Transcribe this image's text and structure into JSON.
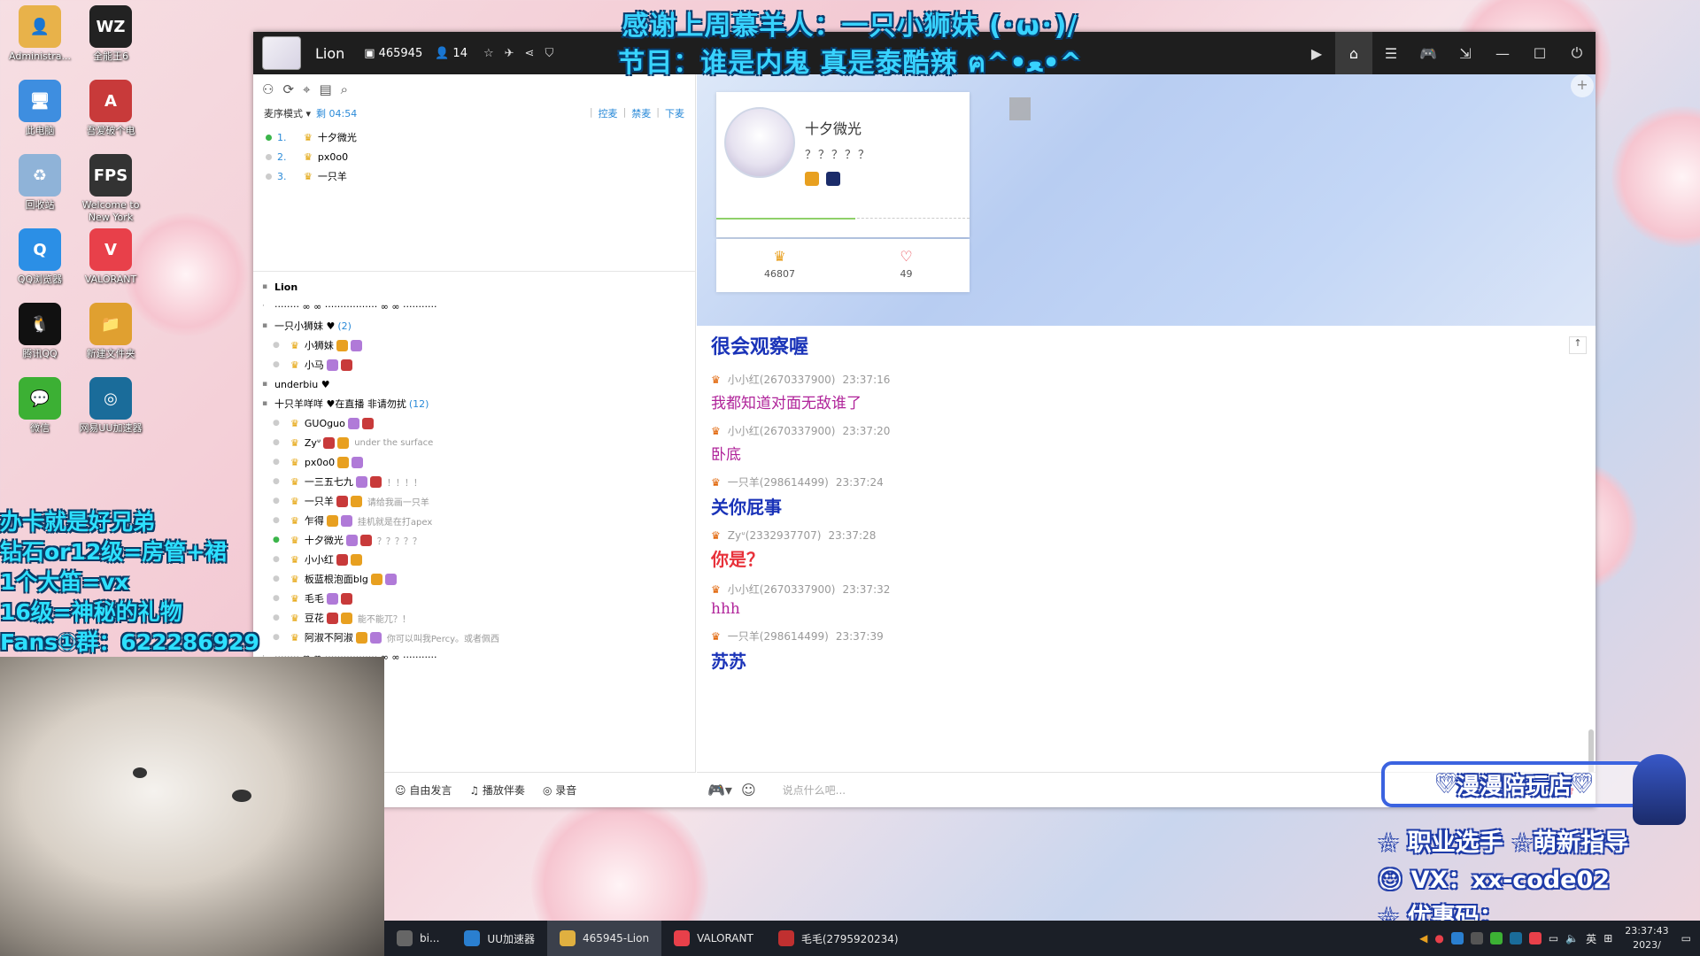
{
  "banner": {
    "line1": "感谢上周慕羊人：一只小狮妹 (･ω･)/",
    "line2": "节目：谁是内鬼 真是泰酷辣 ฅ^•ﻌ•^"
  },
  "desktop_icons": [
    {
      "label": "Administra...",
      "color": "#e8b24a",
      "glyph": "👤"
    },
    {
      "label": "全能王6",
      "color": "#222",
      "glyph": "WZ"
    },
    {
      "label": "此电脑",
      "color": "#3e8ee0",
      "glyph": "🖥"
    },
    {
      "label": "吾爱破个电",
      "color": "#c83a3a",
      "glyph": "A"
    },
    {
      "label": "回收站",
      "color": "#8fb3d8",
      "glyph": "♻"
    },
    {
      "label": "Welcome to New York",
      "color": "#333",
      "glyph": "FPS"
    },
    {
      "label": "QQ浏览器",
      "color": "#2b8fe6",
      "glyph": "Q"
    },
    {
      "label": "VALORANT",
      "color": "#e8404a",
      "glyph": "V"
    },
    {
      "label": "腾讯QQ",
      "color": "#111",
      "glyph": "🐧"
    },
    {
      "label": "新建文件夹",
      "color": "#e0a030",
      "glyph": "📁"
    },
    {
      "label": "微信",
      "color": "#3cb034",
      "glyph": "💬"
    },
    {
      "label": "网易UU加速器",
      "color": "#1a6c9a",
      "glyph": "◎"
    }
  ],
  "promo": {
    "line1": "办卡就是好兄弟",
    "line2": "钻石or12级=房管+裙",
    "line3": "1个大笛=vx",
    "line4": "16级=神秘的礼物",
    "line5": "Fans①群：622286929"
  },
  "titlebar": {
    "name": "Lion",
    "room_id": "465945",
    "online": "14",
    "icons": [
      "star-icon",
      "fly-icon",
      "share-icon",
      "shield-icon"
    ],
    "right_buttons": [
      "video-icon",
      "home-icon",
      "list-icon",
      "gamepad-icon",
      "download-icon",
      "minimize-icon",
      "maximize-icon",
      "power-icon"
    ]
  },
  "left": {
    "mode_label": "麦序模式",
    "timer": "剩 04:54",
    "ops": [
      "控麦",
      "禁麦",
      "下麦"
    ],
    "queue": [
      {
        "num": "1.",
        "name": "十夕微光",
        "on": true
      },
      {
        "num": "2.",
        "name": "px0o0",
        "on": false
      },
      {
        "num": "3.",
        "name": "一只羊",
        "on": false
      }
    ],
    "channels": [
      {
        "kind": "ch",
        "name": "Lion",
        "bold": true
      },
      {
        "kind": "sep",
        "name": "········ ∞ ∞ ················· ∞ ∞ ···········"
      },
      {
        "kind": "ch",
        "name": "一只小狮妹 ♥",
        "count": "(2)"
      },
      {
        "kind": "user",
        "name": "小狮妹",
        "sig": ""
      },
      {
        "kind": "user",
        "name": "小马",
        "sig": ""
      },
      {
        "kind": "ch",
        "name": "underbiu  ♥"
      },
      {
        "kind": "ch",
        "name": "十只羊咩咩 ♥在直播 非请勿扰",
        "count": "(12)"
      },
      {
        "kind": "user",
        "name": "GUOguo",
        "sig": ""
      },
      {
        "kind": "user",
        "name": "Zyᐡ",
        "sig": "under the surface"
      },
      {
        "kind": "user",
        "name": "px0o0",
        "sig": ""
      },
      {
        "kind": "user",
        "name": "一三五七九",
        "sig": "！！！！"
      },
      {
        "kind": "user",
        "name": "一只羊",
        "sig": "请给我画一只羊"
      },
      {
        "kind": "user",
        "name": "乍得",
        "sig": "挂机就是在打apex"
      },
      {
        "kind": "user",
        "name": "十夕微光",
        "sig": "？？？？？",
        "on": true
      },
      {
        "kind": "user",
        "name": "小小红",
        "sig": ""
      },
      {
        "kind": "user",
        "name": "板蓝根泡面blg",
        "sig": ""
      },
      {
        "kind": "user",
        "name": "毛毛",
        "sig": ""
      },
      {
        "kind": "user",
        "name": "豆花",
        "sig": "能不能兀？！"
      },
      {
        "kind": "user",
        "name": "阿淑不阿淑",
        "sig": "你可以叫我Percy。或者佩西"
      },
      {
        "kind": "sep",
        "name": "········ ∞ ∞ ················· ∞ ∞ ···········"
      }
    ],
    "bottom": [
      "自由发言",
      "播放伴奏",
      "录音"
    ]
  },
  "profile": {
    "name": "十夕微光",
    "signature": "？？？？？",
    "stat1": "46807",
    "stat2": "49",
    "level_progress": 0.55
  },
  "chat": {
    "first": "很会观察喔",
    "messages": [
      {
        "user": "小小红(2670337900)",
        "time": "23:37:16",
        "text": "我都知道对面无敌谁了",
        "color": "#b0249a",
        "size": 17
      },
      {
        "user": "小小红(2670337900)",
        "time": "23:37:20",
        "text": "卧底",
        "color": "#b0249a",
        "size": 17
      },
      {
        "user": "一只羊(298614499)",
        "time": "23:37:24",
        "text": "关你屁事",
        "color": "#1a33b8",
        "size": 20
      },
      {
        "user": "Zyᐡ(2332937707)",
        "time": "23:37:28",
        "text": "你是？",
        "color": "#e8313a",
        "size": 20
      },
      {
        "user": "小小红(2670337900)",
        "time": "23:37:32",
        "text": "hhh",
        "color": "#b0249a",
        "size": 17
      },
      {
        "user": "一只羊(298614499)",
        "time": "23:37:39",
        "text": "苏苏",
        "color": "#1a33b8",
        "size": 20
      }
    ],
    "placeholder": "说点什么吧..."
  },
  "shop": {
    "title": "漫漫陪玩店",
    "line1": "职业选手 ☆萌新指导",
    "line2": "VX：xx-code02",
    "line3": "优惠码："
  },
  "taskbar": {
    "items": [
      {
        "label": "bi...",
        "color": "#666",
        "active": false
      },
      {
        "label": "UU加速器",
        "color": "#2a7fd0",
        "active": false
      },
      {
        "label": "465945-Lion",
        "color": "#e0b040",
        "active": true
      },
      {
        "label": "VALORANT",
        "color": "#e8404a",
        "active": false
      },
      {
        "label": "毛毛(2795920234)",
        "color": "#c03030",
        "active": false
      }
    ],
    "lang": "英",
    "time": "23:37:43",
    "date": "2023/"
  }
}
